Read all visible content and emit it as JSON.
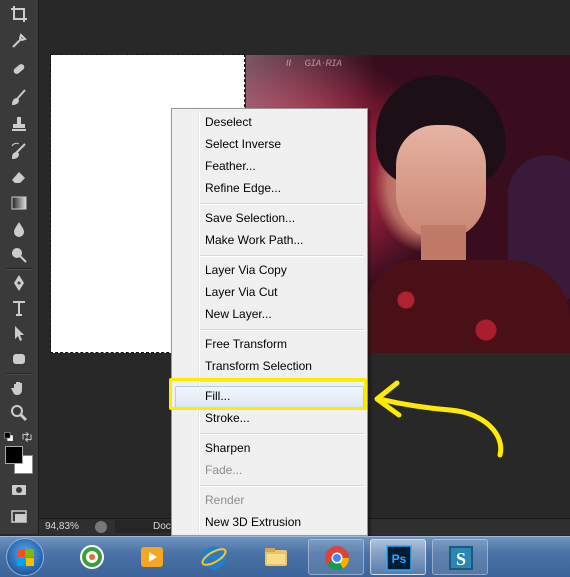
{
  "statusbar": {
    "zoom": "94,83%",
    "doc_label": "Doc"
  },
  "context_menu": {
    "items": [
      {
        "label": "Deselect",
        "enabled": true
      },
      {
        "label": "Select Inverse",
        "enabled": true
      },
      {
        "label": "Feather...",
        "enabled": true
      },
      {
        "label": "Refine Edge...",
        "enabled": true
      },
      {
        "label": "Save Selection...",
        "enabled": true
      },
      {
        "label": "Make Work Path...",
        "enabled": true
      },
      {
        "label": "Layer Via Copy",
        "enabled": true
      },
      {
        "label": "Layer Via Cut",
        "enabled": true
      },
      {
        "label": "New Layer...",
        "enabled": true
      },
      {
        "label": "Free Transform",
        "enabled": true
      },
      {
        "label": "Transform Selection",
        "enabled": true
      },
      {
        "label": "Fill...",
        "enabled": true,
        "highlighted": true
      },
      {
        "label": "Stroke...",
        "enabled": true
      },
      {
        "label": "Sharpen",
        "enabled": true
      },
      {
        "label": "Fade...",
        "enabled": false
      },
      {
        "label": "Render",
        "enabled": false
      },
      {
        "label": "New 3D Extrusion",
        "enabled": true
      }
    ]
  },
  "tools": [
    "crop-icon",
    "eyedropper-icon",
    "healing-brush-icon",
    "brush-icon",
    "clone-stamp-icon",
    "history-brush-icon",
    "eraser-icon",
    "gradient-icon",
    "blur-icon",
    "dodge-icon",
    "pen-icon",
    "type-icon",
    "path-selection-icon",
    "shape-icon",
    "hand-icon",
    "zoom-icon",
    "swap-colors-icon",
    "default-colors-icon",
    "quick-mask-icon",
    "screen-mode-icon"
  ],
  "taskbar": {
    "apps": [
      "windows-start-icon",
      "coccoc-browser-icon",
      "media-player-icon",
      "internet-explorer-icon",
      "file-explorer-icon",
      "chrome-icon",
      "photoshop-icon",
      "s-app-icon"
    ],
    "ps_label": "Ps",
    "s_label": "S"
  },
  "colors": {
    "annotation": "#ffeb00",
    "menu_highlight": "#dde8f6",
    "menu_bg": "#f0f0f0",
    "ps_blue": "#001d34"
  }
}
